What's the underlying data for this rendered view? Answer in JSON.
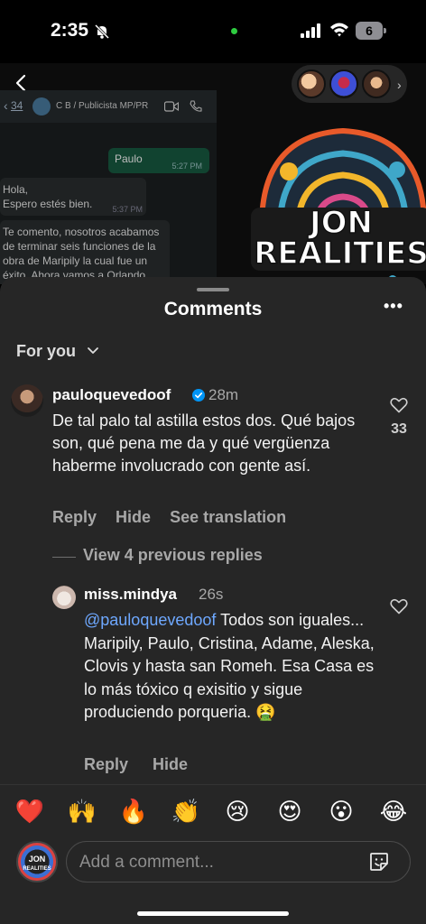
{
  "status_bar": {
    "time": "2:35",
    "battery": "6"
  },
  "background_post": {
    "chat": {
      "back_count": "34",
      "contact": "C B / Publicista MP/PR",
      "sent_message": "Paulo",
      "sent_time": "5:27 PM",
      "received_line1": "Hola,",
      "received_line2": "Espero estés bien.",
      "received_time": "5:37 PM",
      "received_long": "Te comento, nosotros acabamos de terminar seis funciones de la obra de Maripily la cual fue un éxito. Ahora vamos a Orlando, New York..."
    },
    "logo_line1": "JON",
    "logo_line2": "REALITIES"
  },
  "sheet": {
    "title": "Comments",
    "more": "•••",
    "sort_label": "For you"
  },
  "comments": [
    {
      "username": "pauloquevedoof",
      "time": "28m",
      "text": "De tal palo tal astilla estos dos. Qué bajos son, qué pena me da y qué vergüenza haberme involucrado con gente así.",
      "likes": "33",
      "actions": {
        "reply": "Reply",
        "hide": "Hide",
        "translate": "See translation"
      }
    },
    {
      "username": "miss.mindya",
      "time": "26s",
      "mention": "@pauloquevedoof",
      "text": " Todos son iguales... Maripily, Paulo, Cristina, Adame, Aleska, Clovis y hasta san Romeh. Esa Casa es lo más tóxico q exisitio y sigue produciendo porqueria. 🤮",
      "actions": {
        "reply": "Reply",
        "hide": "Hide"
      }
    }
  ],
  "view_replies": "View 4 previous replies",
  "quick_reactions": [
    "❤️",
    "🙌",
    "🔥",
    "👏",
    "😢",
    "😍",
    "😮",
    "😂"
  ],
  "composer": {
    "placeholder": "Add a comment...",
    "avatar_line1": "JON",
    "avatar_line2": "REALITIES"
  },
  "colors": {
    "sheet_bg": "#262626",
    "mention": "#6ea8ff",
    "verified": "#0095f6"
  }
}
